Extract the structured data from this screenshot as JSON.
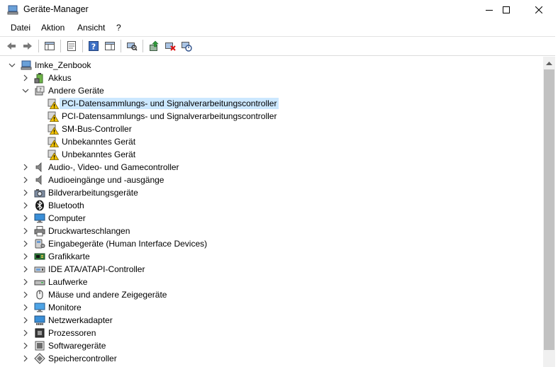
{
  "window": {
    "title": "Geräte-Manager"
  },
  "menu": [
    "Datei",
    "Aktion",
    "Ansicht",
    "?"
  ],
  "tree": {
    "root": "Imke_Zenbook",
    "items": [
      {
        "label": "Akkus",
        "icon": "battery-icon",
        "level": 1,
        "state": "collapsed"
      },
      {
        "label": "Andere Geräte",
        "icon": "other-devices-icon",
        "level": 1,
        "state": "expanded"
      },
      {
        "label": "PCI-Datensammlungs- und Signalverarbeitungscontroller",
        "icon": "warning-device-icon",
        "level": 2,
        "state": "leaf",
        "selected": true
      },
      {
        "label": "PCI-Datensammlungs- und Signalverarbeitungscontroller",
        "icon": "warning-device-icon",
        "level": 2,
        "state": "leaf"
      },
      {
        "label": "SM-Bus-Controller",
        "icon": "warning-device-icon",
        "level": 2,
        "state": "leaf"
      },
      {
        "label": "Unbekanntes Gerät",
        "icon": "warning-device-icon",
        "level": 2,
        "state": "leaf"
      },
      {
        "label": "Unbekanntes Gerät",
        "icon": "warning-device-icon",
        "level": 2,
        "state": "leaf"
      },
      {
        "label": "Audio-, Video- und Gamecontroller",
        "icon": "speaker-icon",
        "level": 1,
        "state": "collapsed"
      },
      {
        "label": "Audioeingänge und -ausgänge",
        "icon": "speaker-icon",
        "level": 1,
        "state": "collapsed"
      },
      {
        "label": "Bildverarbeitungsgeräte",
        "icon": "camera-icon",
        "level": 1,
        "state": "collapsed"
      },
      {
        "label": "Bluetooth",
        "icon": "bluetooth-icon",
        "level": 1,
        "state": "collapsed"
      },
      {
        "label": "Computer",
        "icon": "computer-icon",
        "level": 1,
        "state": "collapsed"
      },
      {
        "label": "Druckwarteschlangen",
        "icon": "printer-icon",
        "level": 1,
        "state": "collapsed"
      },
      {
        "label": "Eingabegeräte (Human Interface Devices)",
        "icon": "hid-icon",
        "level": 1,
        "state": "collapsed"
      },
      {
        "label": "Grafikkarte",
        "icon": "display-adapter-icon",
        "level": 1,
        "state": "collapsed"
      },
      {
        "label": "IDE ATA/ATAPI-Controller",
        "icon": "ide-controller-icon",
        "level": 1,
        "state": "collapsed"
      },
      {
        "label": "Laufwerke",
        "icon": "disk-drive-icon",
        "level": 1,
        "state": "collapsed"
      },
      {
        "label": "Mäuse und andere Zeigegeräte",
        "icon": "mouse-icon",
        "level": 1,
        "state": "collapsed"
      },
      {
        "label": "Monitore",
        "icon": "monitor-icon",
        "level": 1,
        "state": "collapsed"
      },
      {
        "label": "Netzwerkadapter",
        "icon": "network-adapter-icon",
        "level": 1,
        "state": "collapsed"
      },
      {
        "label": "Prozessoren",
        "icon": "processor-icon",
        "level": 1,
        "state": "collapsed"
      },
      {
        "label": "Softwaregeräte",
        "icon": "software-device-icon",
        "level": 1,
        "state": "collapsed"
      },
      {
        "label": "Speichercontroller",
        "icon": "storage-controller-icon",
        "level": 1,
        "state": "collapsed"
      }
    ]
  },
  "colors": {
    "selection": "#cce8ff",
    "warning": "#f2c200",
    "scrollbar_thumb": "#c1c1c1"
  }
}
